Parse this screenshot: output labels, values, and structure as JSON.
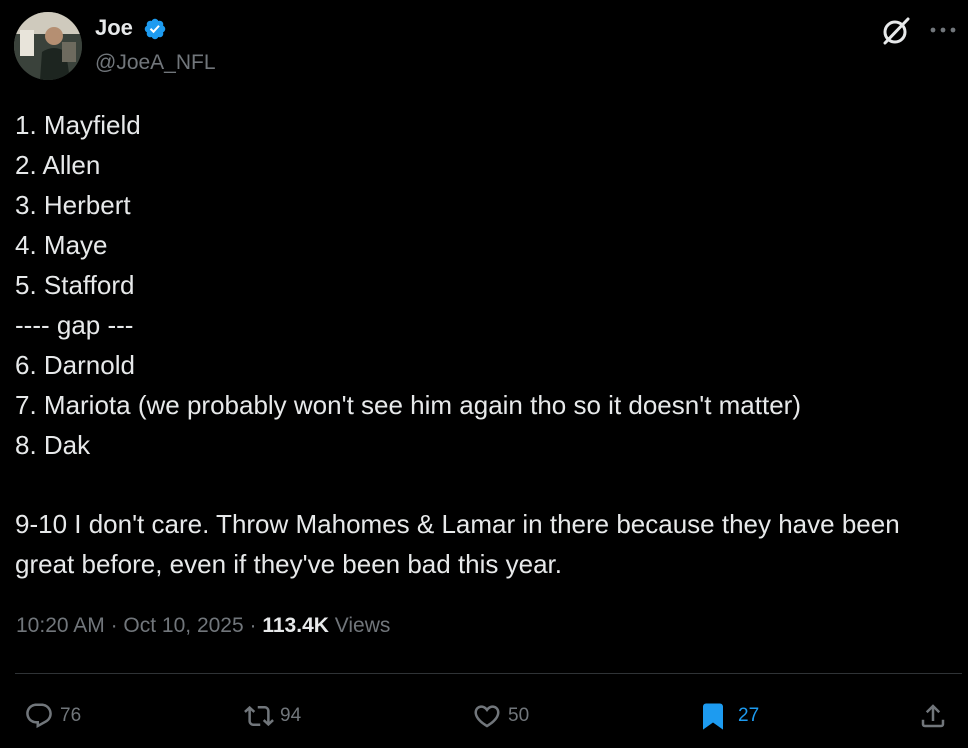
{
  "author": {
    "display_name": "Joe",
    "handle": "@JoeA_NFL",
    "verified": true
  },
  "tweet": {
    "lines": [
      "1. Mayfield",
      "2. Allen",
      "3. Herbert",
      "4. Maye",
      "5. Stafford",
      "---- gap ---",
      "6. Darnold",
      "7. Mariota (we probably won't see him again tho so it doesn't matter)",
      "8. Dak"
    ],
    "paragraph": "9-10 I don't care. Throw Mahomes & Lamar in there because they have been great before, even if they've been bad this year."
  },
  "meta": {
    "time": "10:20 AM",
    "separator": "·",
    "date": "Oct 10, 2025",
    "views_count": "113.4K",
    "views_label": "Views"
  },
  "actions": {
    "replies": "76",
    "reposts": "94",
    "likes": "50",
    "bookmarks": "27"
  },
  "colors": {
    "background": "#000000",
    "text": "#e7e9ea",
    "muted": "#71767b",
    "accent": "#1d9bf0",
    "divider": "#2f3336"
  },
  "icons": {
    "verified": "verified-badge-icon",
    "grok": "grok-icon",
    "more": "more-icon",
    "reply": "reply-icon",
    "repost": "repost-icon",
    "like": "heart-icon",
    "bookmark": "bookmark-icon",
    "share": "share-icon"
  }
}
